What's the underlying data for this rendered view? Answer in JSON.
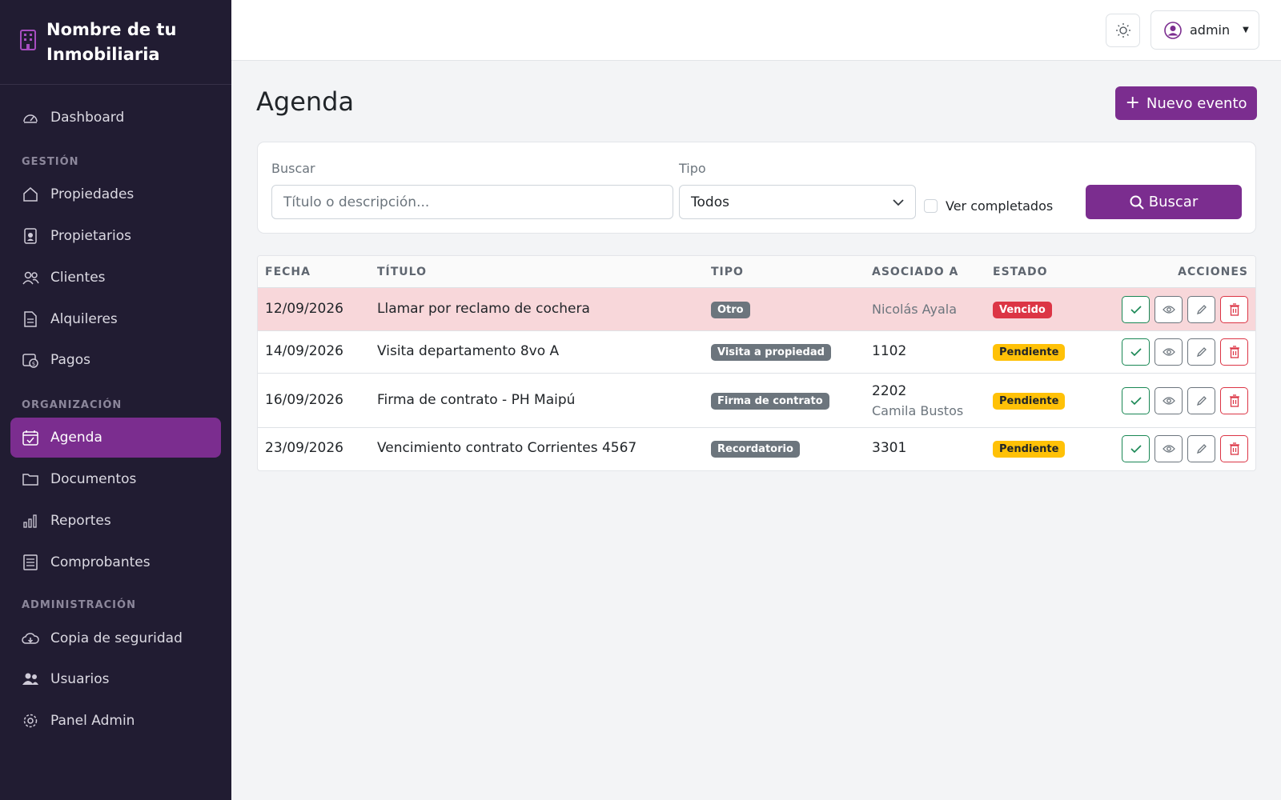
{
  "brand": {
    "name": "Nombre de tu Inmobiliaria"
  },
  "sidebar": {
    "dashboard": "Dashboard",
    "section_gestion": "GESTIÓN",
    "propiedades": "Propiedades",
    "propietarios": "Propietarios",
    "clientes": "Clientes",
    "alquileres": "Alquileres",
    "pagos": "Pagos",
    "section_organizacion": "ORGANIZACIÓN",
    "agenda": "Agenda",
    "documentos": "Documentos",
    "reportes": "Reportes",
    "comprobantes": "Comprobantes",
    "section_administracion": "ADMINISTRACIÓN",
    "copia": "Copia de seguridad",
    "usuarios": "Usuarios",
    "panel": "Panel Admin"
  },
  "topbar": {
    "user": "admin"
  },
  "page": {
    "title": "Agenda",
    "new_button": "Nuevo evento"
  },
  "filters": {
    "search_label": "Buscar",
    "search_placeholder": "Título o descripción...",
    "search_value": "",
    "type_label": "Tipo",
    "type_value": "Todos",
    "show_completed": "Ver completados",
    "search_button": "Buscar"
  },
  "table": {
    "headers": {
      "fecha": "FECHA",
      "titulo": "TÍTULO",
      "tipo": "TIPO",
      "asociado": "ASOCIADO A",
      "estado": "ESTADO",
      "acciones": "ACCIONES"
    },
    "rows": [
      {
        "fecha": "12/09/2026",
        "titulo": "Llamar por reclamo de cochera",
        "tipo": "Otro",
        "asociado": "",
        "asociado_sub": "Nicolás Ayala",
        "estado": "Vencido"
      },
      {
        "fecha": "14/09/2026",
        "titulo": "Visita departamento 8vo A",
        "tipo": "Visita a propiedad",
        "asociado": "1102",
        "asociado_sub": "",
        "estado": "Pendiente"
      },
      {
        "fecha": "16/09/2026",
        "titulo": "Firma de contrato - PH Maipú",
        "tipo": "Firma de contrato",
        "asociado": "2202",
        "asociado_sub": "Camila Bustos",
        "estado": "Pendiente"
      },
      {
        "fecha": "23/09/2026",
        "titulo": "Vencimiento contrato Corrientes 4567",
        "tipo": "Recordatorio",
        "asociado": "3301",
        "asociado_sub": "",
        "estado": "Pendiente"
      }
    ]
  },
  "colors": {
    "sidebar_bg": "#211c32",
    "accent": "#7b2d8f",
    "danger": "#dc3545",
    "warning": "#ffc107",
    "success": "#198754"
  }
}
